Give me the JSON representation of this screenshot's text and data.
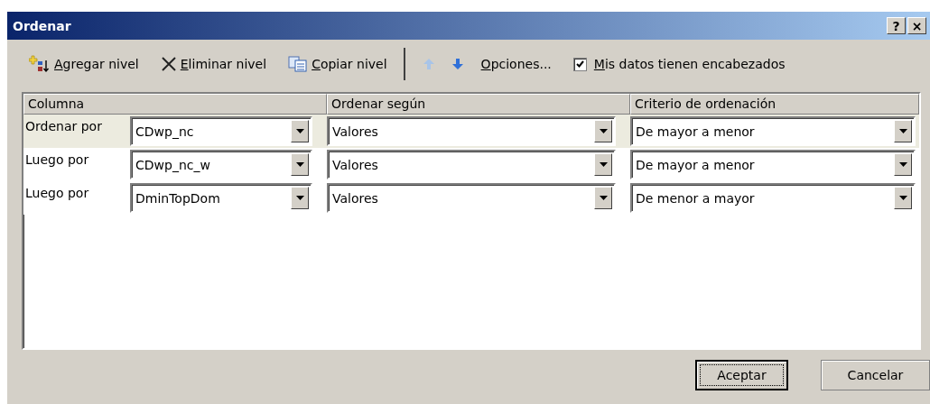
{
  "window": {
    "title": "Ordenar",
    "help": "?",
    "close": "×"
  },
  "toolbar": [
    {
      "kind": "add",
      "label": "Agregar nivel",
      "mnemonic": true
    },
    {
      "kind": "delete",
      "label": "Eliminar nivel",
      "mnemonic": true
    },
    {
      "kind": "copy",
      "label": "Copiar nivel",
      "mnemonic": true
    },
    {
      "kind": "separator"
    },
    {
      "kind": "up",
      "disabled": true
    },
    {
      "kind": "down",
      "disabled": false
    },
    {
      "kind": "options",
      "label": "Opciones...",
      "mnemonic": true
    },
    {
      "kind": "checkbox",
      "label": "Mis datos tienen encabezados",
      "mnemonic": true,
      "checked": true
    }
  ],
  "table": {
    "columns": [
      "Columna",
      "Ordenar según",
      "Criterio de ordenación"
    ],
    "rows": [
      {
        "label": "Ordenar por",
        "column": "CDwp_nc",
        "sort_on": "Valores",
        "order": "De mayor a menor",
        "selected": true
      },
      {
        "label": "Luego por",
        "column": "CDwp_nc_w",
        "sort_on": "Valores",
        "order": "De mayor a menor",
        "selected": false
      },
      {
        "label": "Luego por",
        "column": "DminTopDom",
        "sort_on": "Valores",
        "order": "De menor a mayor",
        "selected": false
      }
    ]
  },
  "buttons": [
    {
      "label": "Aceptar",
      "default": true
    },
    {
      "label": "Cancelar",
      "default": false
    }
  ]
}
